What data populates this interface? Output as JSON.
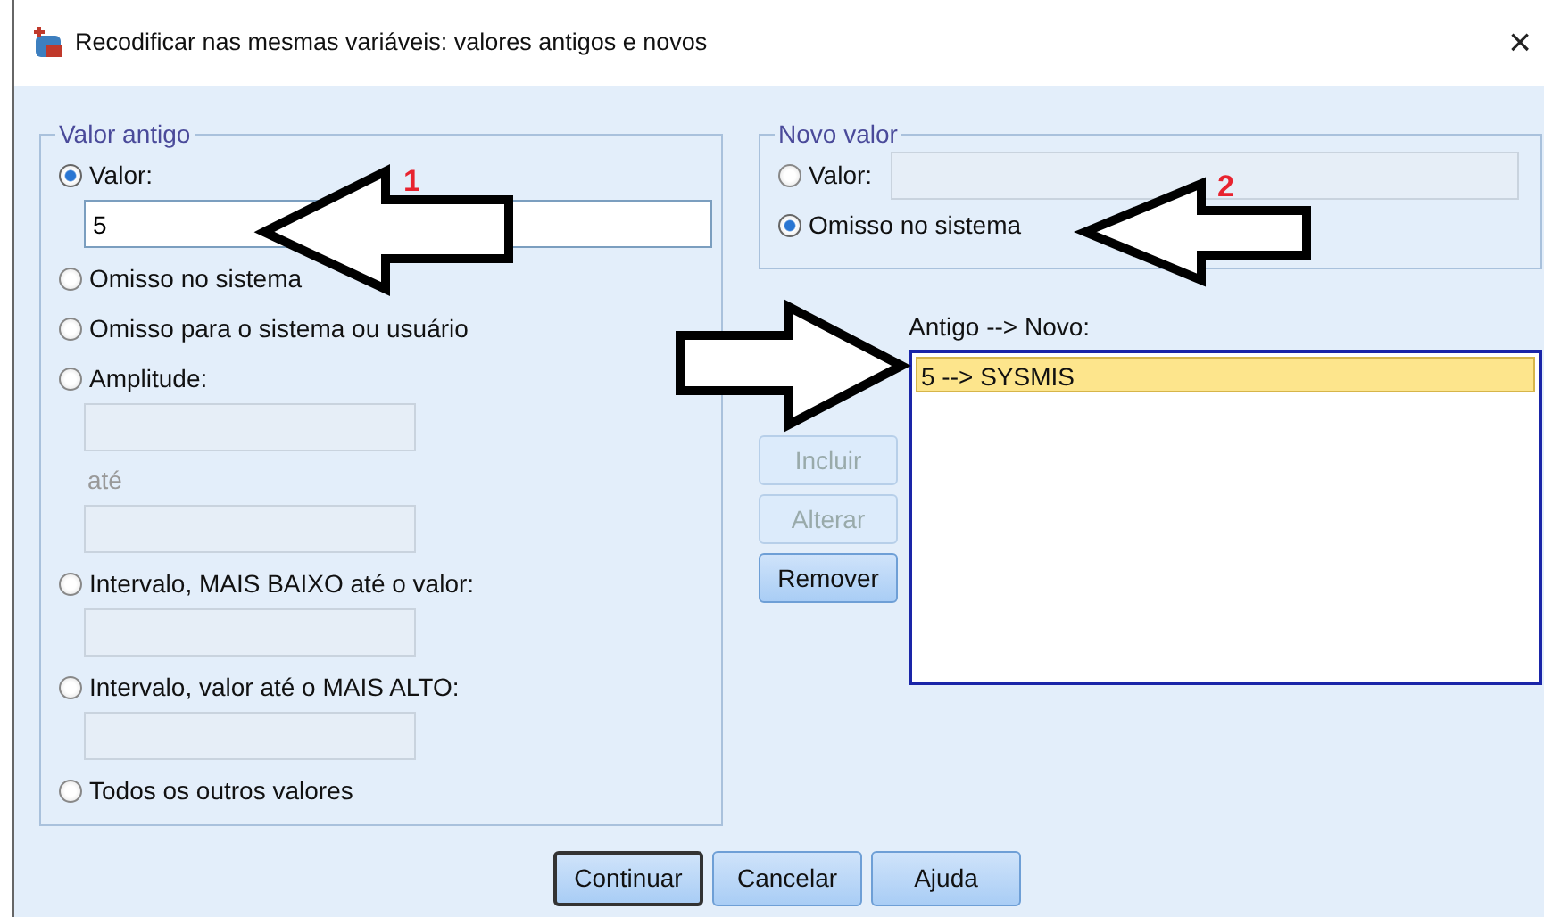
{
  "window": {
    "title": "Recodificar nas mesmas variáveis: valores antigos e novos",
    "close": "×"
  },
  "old_value": {
    "legend": "Valor antigo",
    "options": [
      {
        "kind": "field",
        "label": "Valor:",
        "selected": true,
        "value": "5"
      },
      {
        "kind": "radio",
        "label": "Omisso no sistema",
        "selected": false
      },
      {
        "kind": "radio",
        "label": "Omisso para o sistema ou usuário",
        "selected": false
      },
      {
        "kind": "range",
        "label": "Amplitude:",
        "selected": false,
        "range_label": "até"
      },
      {
        "kind": "field",
        "label": "Intervalo, MAIS BAIXO até o valor:",
        "selected": false
      },
      {
        "kind": "field",
        "label": "Intervalo, valor até o MAIS ALTO:",
        "selected": false
      },
      {
        "kind": "radio",
        "label": "Todos os outros valores",
        "selected": false
      }
    ]
  },
  "new_value": {
    "legend": "Novo valor",
    "options": [
      {
        "kind": "inline-field",
        "label": "Valor:",
        "selected": false
      },
      {
        "kind": "radio",
        "label": "Omisso no sistema",
        "selected": true
      }
    ]
  },
  "mapping": {
    "label": "Antigo --> Novo:",
    "items": [
      {
        "text": "5 --> SYSMIS",
        "selected": true
      }
    ]
  },
  "list_buttons": [
    {
      "label": "Incluir",
      "disabled": true
    },
    {
      "label": "Alterar",
      "disabled": true
    },
    {
      "label": "Remover",
      "disabled": false
    }
  ],
  "buttons": [
    {
      "label": "Continuar",
      "default": true
    },
    {
      "label": "Cancelar",
      "default": false
    },
    {
      "label": "Ajuda",
      "default": false
    }
  ],
  "annotations": [
    "1",
    "2"
  ]
}
